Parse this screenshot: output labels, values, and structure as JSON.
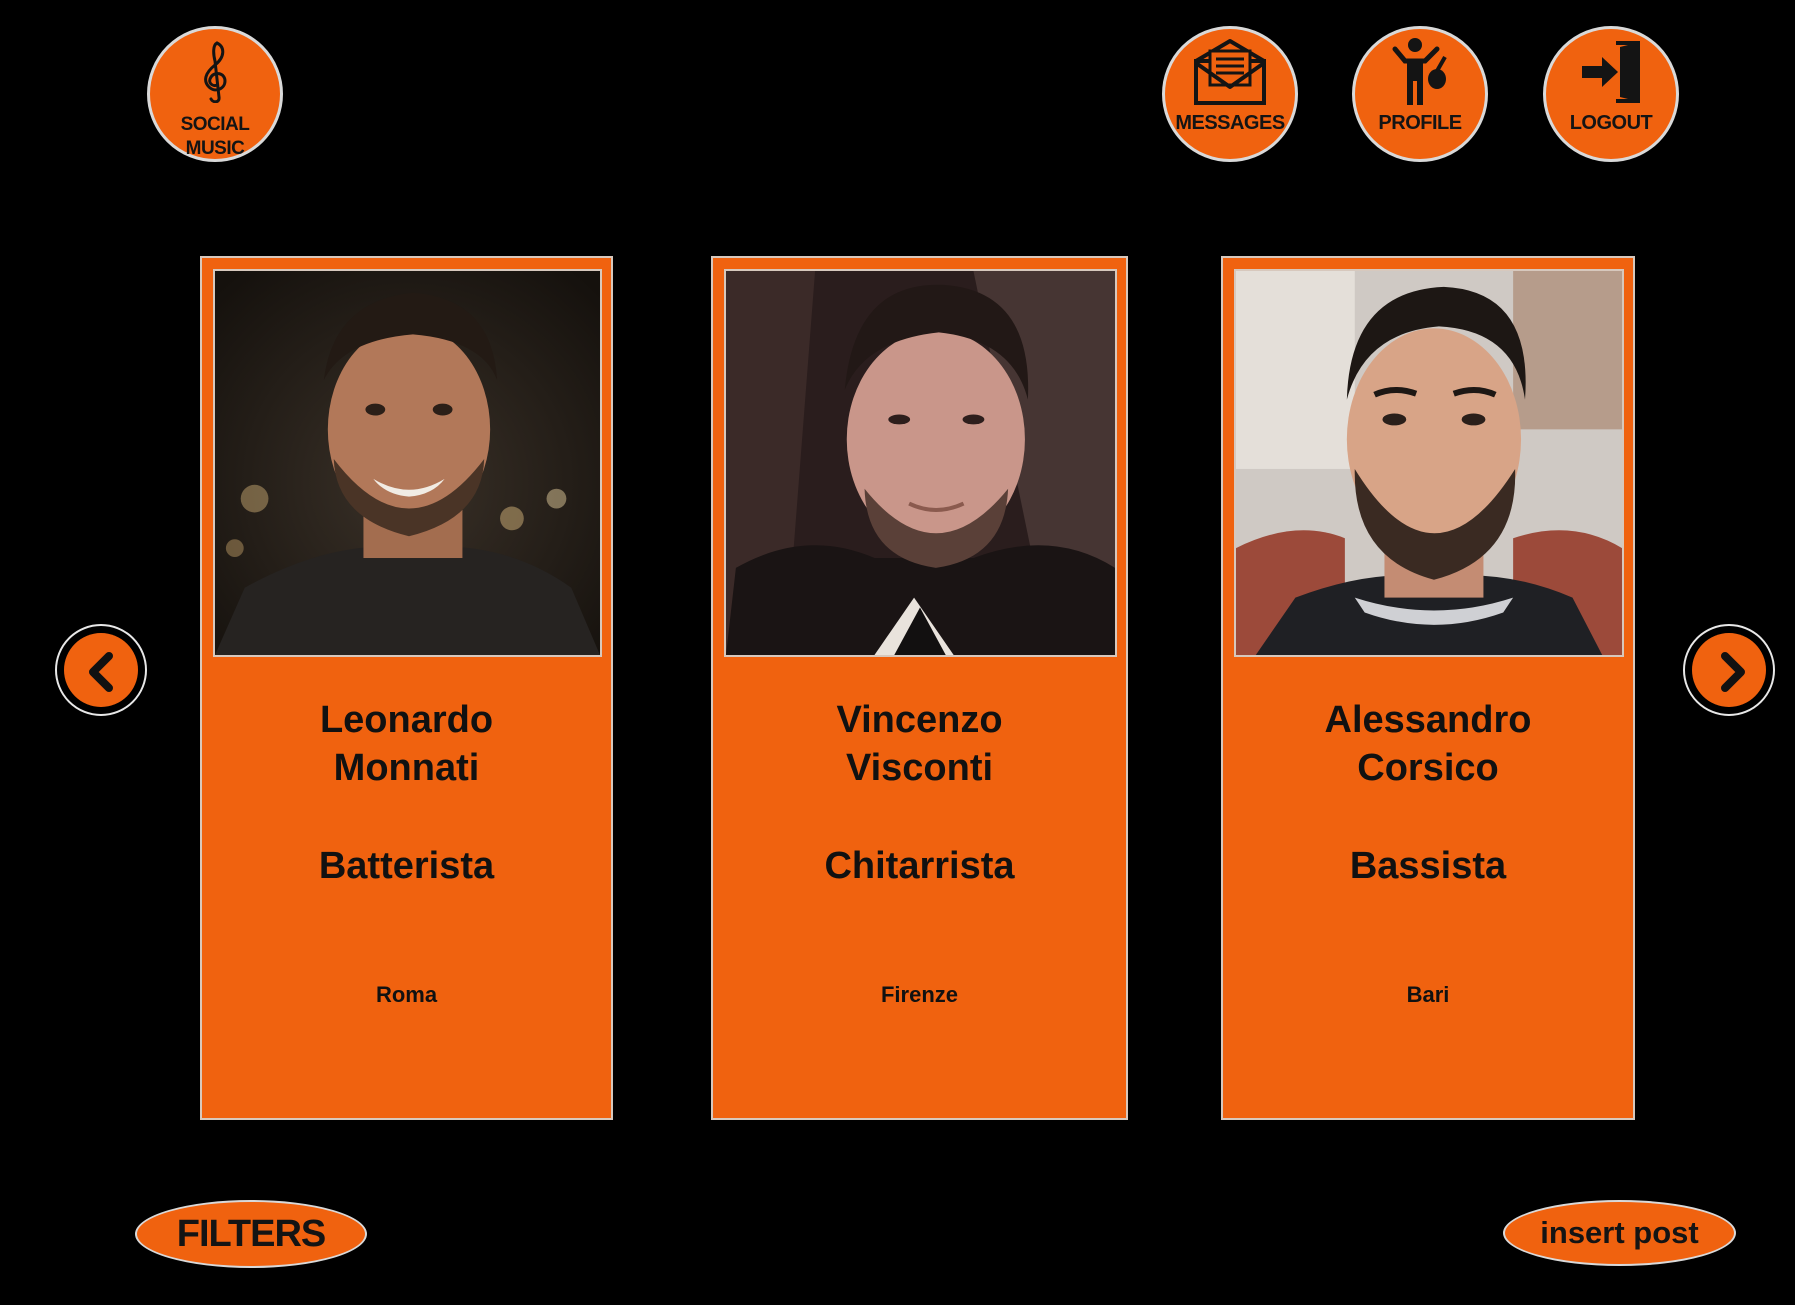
{
  "header": {
    "logo_label_line1": "SOCIAL",
    "logo_label_line2": "MUSIC",
    "logo_icon": "treble-clef-icon",
    "messages_label": "MESSAGES",
    "messages_icon": "envelope-icon",
    "profile_label": "PROFILE",
    "profile_icon": "musician-icon",
    "logout_label": "LOGOUT",
    "logout_icon": "exit-door-icon"
  },
  "carousel": {
    "prev_icon": "chevron-left-icon",
    "next_icon": "chevron-right-icon",
    "cards": [
      {
        "first_name": "Leonardo",
        "last_name": "Monnati",
        "role": "Batterista",
        "city": "Roma"
      },
      {
        "first_name": "Vincenzo",
        "last_name": "Visconti",
        "role": "Chitarrista",
        "city": "Firenze"
      },
      {
        "first_name": "Alessandro",
        "last_name": "Corsico",
        "role": "Bassista",
        "city": "Bari"
      }
    ]
  },
  "footer": {
    "filters_label": "FILTERS",
    "insert_post_label": "insert post"
  },
  "colors": {
    "accent": "#f0620f",
    "background": "#000000",
    "text": "#111111",
    "border": "#d7c8bd"
  }
}
